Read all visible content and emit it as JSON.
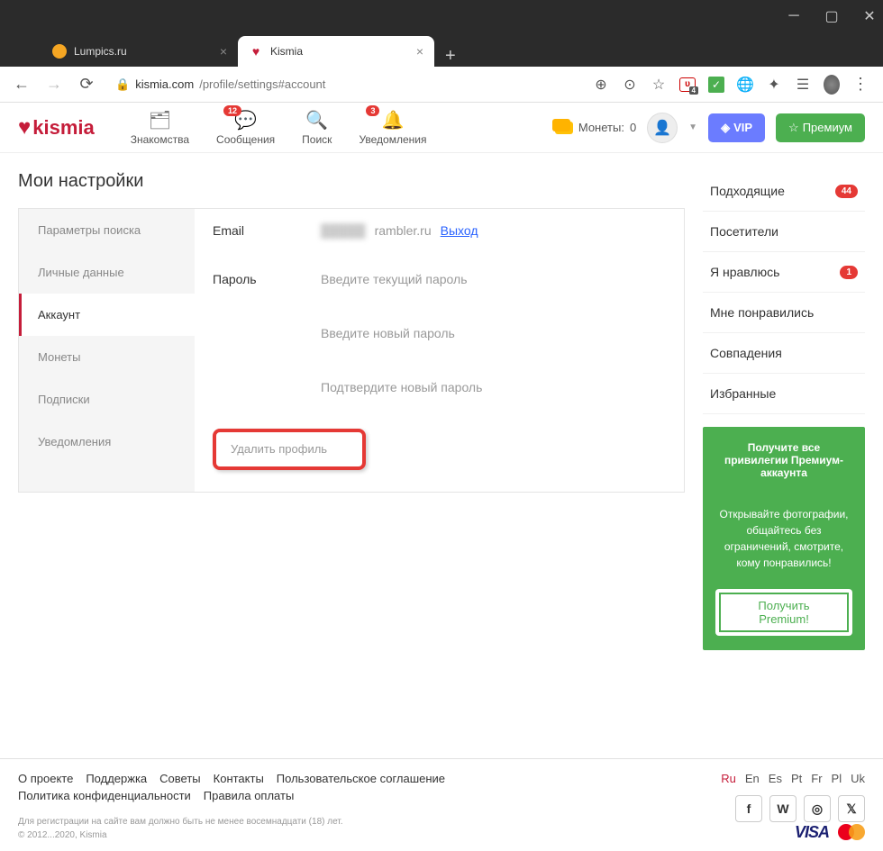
{
  "browser": {
    "tabs": [
      {
        "title": "Lumpics.ru",
        "active": false
      },
      {
        "title": "Kismia",
        "active": true
      }
    ],
    "url_domain": "kismia.com",
    "url_path": "/profile/settings#account"
  },
  "header": {
    "logo": "kismia",
    "nav": {
      "dating": "Знакомства",
      "messages": "Сообщения",
      "messages_badge": "12",
      "search": "Поиск",
      "notifications": "Уведомления",
      "notifications_badge": "3"
    },
    "coins_label": "Монеты:",
    "coins_value": "0",
    "vip_label": "VIP",
    "premium_label": "Премиум"
  },
  "settings": {
    "title": "Мои настройки",
    "tabs": {
      "search_params": "Параметры поиска",
      "personal": "Личные данные",
      "account": "Аккаунт",
      "coins": "Монеты",
      "subscriptions": "Подписки",
      "notifications": "Уведомления"
    },
    "form": {
      "email_label": "Email",
      "email_value": "rambler.ru",
      "logout": "Выход",
      "password_label": "Пароль",
      "pw_current": "Введите текущий пароль",
      "pw_new": "Введите новый пароль",
      "pw_confirm": "Подтвердите новый пароль",
      "delete_profile": "Удалить профиль"
    }
  },
  "sidebar": {
    "items": {
      "matches": "Подходящие",
      "matches_badge": "44",
      "visitors": "Посетители",
      "i_like": "Я нравлюсь",
      "i_like_badge": "1",
      "liked_me": "Мне понравились",
      "coincidences": "Совпадения",
      "favorites": "Избранные"
    },
    "promo": {
      "title": "Получите все привилегии Премиум-аккаунта",
      "body": "Открывайте фотографии, общайтесь без ограничений, смотрите, кому понравились!",
      "button": "Получить Premium!"
    }
  },
  "footer": {
    "links": {
      "about": "О проекте",
      "support": "Поддержка",
      "tips": "Советы",
      "contacts": "Контакты",
      "agreement": "Пользовательское соглашение",
      "privacy": "Политика конфиденциальности",
      "payment": "Правила оплаты"
    },
    "langs": [
      "Ru",
      "En",
      "Es",
      "Pt",
      "Fr",
      "Pl",
      "Uk"
    ],
    "legal1": "Для регистрации на сайте вам должно быть не менее восемнадцати (18) лет.",
    "legal2": "© 2012...2020, Kismia",
    "visa": "VISA"
  }
}
